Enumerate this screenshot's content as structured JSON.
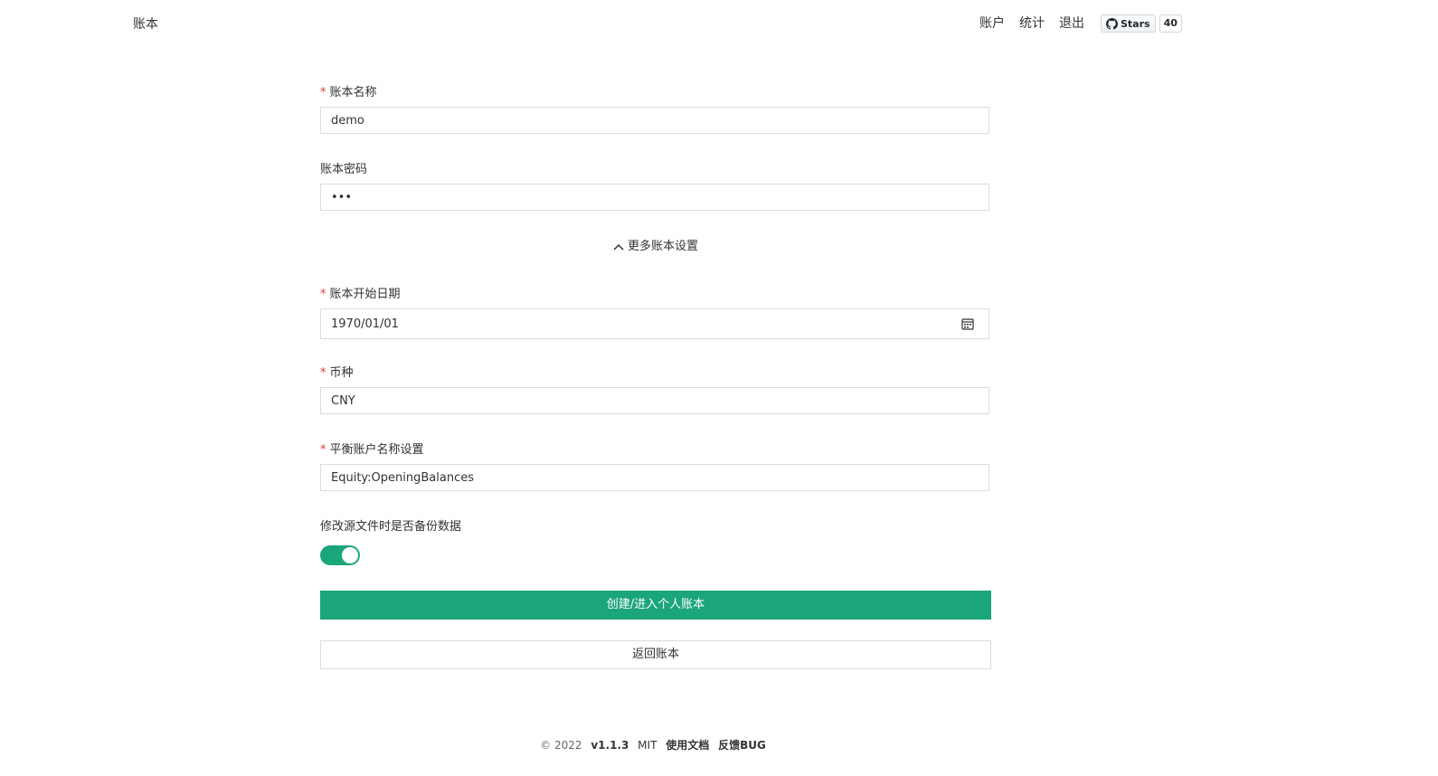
{
  "header": {
    "title": "账本",
    "nav": [
      "账户",
      "统计",
      "退出"
    ],
    "github": {
      "label": "Stars",
      "count": "40"
    }
  },
  "form": {
    "name": {
      "label": "账本名称",
      "value": "demo",
      "required": true
    },
    "password": {
      "label": "账本密码",
      "value": "•••"
    },
    "more_settings": "更多账本设置",
    "start_date": {
      "label": "账本开始日期",
      "value": "1970/01/01",
      "required": true
    },
    "currency": {
      "label": "币种",
      "value": "CNY",
      "required": true
    },
    "balance_account": {
      "label": "平衡账户名称设置",
      "value": "Equity:OpeningBalances",
      "required": true
    },
    "backup": {
      "label": "修改源文件时是否备份数据",
      "enabled": true
    },
    "submit": "创建/进入个人账本",
    "back": "返回账本"
  },
  "footer": {
    "copyright": "© 2022",
    "version": "v1.1.3",
    "license": "MIT",
    "docs": "使用文档",
    "feedback": "反馈BUG"
  },
  "colors": {
    "primary": "#1ba57b",
    "required": "#e0393e"
  }
}
